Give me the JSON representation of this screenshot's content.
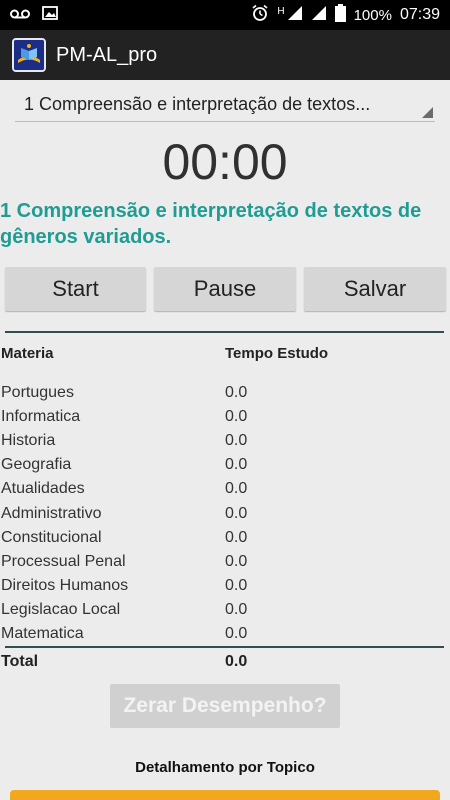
{
  "status_bar": {
    "battery": "100%",
    "time": "07:39",
    "network": "H",
    "icons": [
      "voicemail-icon",
      "image-icon",
      "alarm-icon",
      "signal-icon",
      "battery-icon"
    ]
  },
  "app_bar": {
    "title": "PM-AL_pro",
    "icon": "book-app-icon"
  },
  "spinner": {
    "selected": "1 Compreensão e interpretação de textos..."
  },
  "timer": "00:00",
  "topic_title": "1 Compreensão e interpretação de textos de gêneros variados.",
  "buttons": {
    "start": "Start",
    "pause": "Pause",
    "salvar": "Salvar"
  },
  "table": {
    "headers": {
      "materia": "Materia",
      "tempo": "Tempo Estudo"
    },
    "rows": [
      {
        "materia": "Portugues",
        "tempo": "0.0"
      },
      {
        "materia": "Informatica",
        "tempo": "0.0"
      },
      {
        "materia": "Historia",
        "tempo": "0.0"
      },
      {
        "materia": "Geografia",
        "tempo": "0.0"
      },
      {
        "materia": "Atualidades",
        "tempo": "0.0"
      },
      {
        "materia": "Administrativo",
        "tempo": "0.0"
      },
      {
        "materia": "Constitucional",
        "tempo": "0.0"
      },
      {
        "materia": "Processual Penal",
        "tempo": "0.0"
      },
      {
        "materia": "Direitos Humanos",
        "tempo": "0.0"
      },
      {
        "materia": "Legislacao Local",
        "tempo": "0.0"
      },
      {
        "materia": "Matematica",
        "tempo": "0.0"
      }
    ],
    "total_label": "Total",
    "total_value": "0.0"
  },
  "reset_button": "Zerar Desempenho?",
  "detail_heading": "Detalhamento por Topico",
  "colors": {
    "accent_teal": "#1f9c93",
    "orange": "#f2a81c",
    "button_bg": "#d6d6d6",
    "app_bar_bg": "#222222"
  }
}
